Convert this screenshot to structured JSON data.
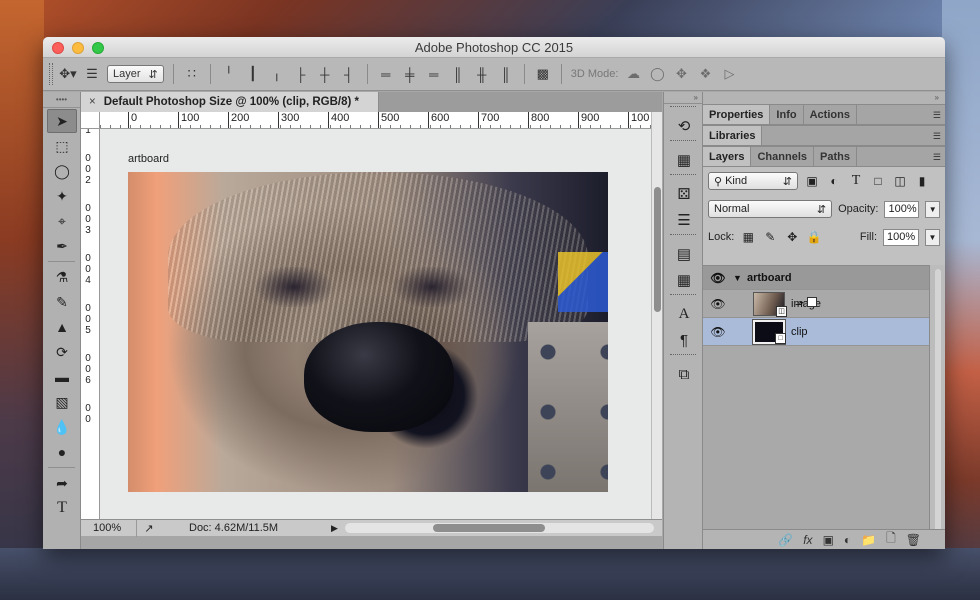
{
  "window": {
    "title": "Adobe Photoshop CC 2015"
  },
  "options_bar": {
    "auto_select_target": "Layer",
    "threed_mode_label": "3D Mode:"
  },
  "document": {
    "tab_title": "Default Photoshop Size @ 100% (clip, RGB/8) *",
    "artboard_label": "artboard",
    "ruler_h_ticks": [
      "0",
      "100",
      "200",
      "300",
      "400",
      "500",
      "600",
      "700",
      "800",
      "900",
      "100"
    ],
    "ruler_v_ticks": [
      "0",
      "0",
      "1",
      "0",
      "0",
      "2",
      "0",
      "0",
      "3",
      "0",
      "0",
      "4",
      "0",
      "0",
      "5",
      "0",
      "0",
      "6",
      "0",
      "0"
    ],
    "zoom": "100%",
    "doc_info": "Doc: 4.62M/11.5M"
  },
  "panels": {
    "tabs_top": [
      "Properties",
      "Info",
      "Actions"
    ],
    "tabs_libraries": [
      "Libraries"
    ],
    "tabs_layers": [
      "Layers",
      "Channels",
      "Paths"
    ],
    "filter_kind": "Kind",
    "blend_mode": "Normal",
    "opacity_label": "Opacity:",
    "opacity_value": "100%",
    "lock_label": "Lock:",
    "fill_label": "Fill:",
    "fill_value": "100%",
    "layers": [
      {
        "name": "artboard",
        "type": "group"
      },
      {
        "name": "image",
        "type": "smart-object"
      },
      {
        "name": "clip",
        "type": "shape"
      }
    ]
  },
  "icons": {
    "toolbox": [
      "move-icon",
      "marquee-icon",
      "lasso-icon",
      "magic-wand-icon",
      "crop-icon",
      "eyedropper-icon",
      "healing-brush-icon",
      "brush-icon",
      "clone-stamp-icon",
      "history-brush-icon",
      "eraser-icon",
      "gradient-icon",
      "blur-icon",
      "dodge-icon",
      "path-select-icon",
      "type-icon"
    ]
  },
  "colors": {
    "selected_layer": "#aabbda",
    "window_chrome": "#b4b4b4"
  }
}
